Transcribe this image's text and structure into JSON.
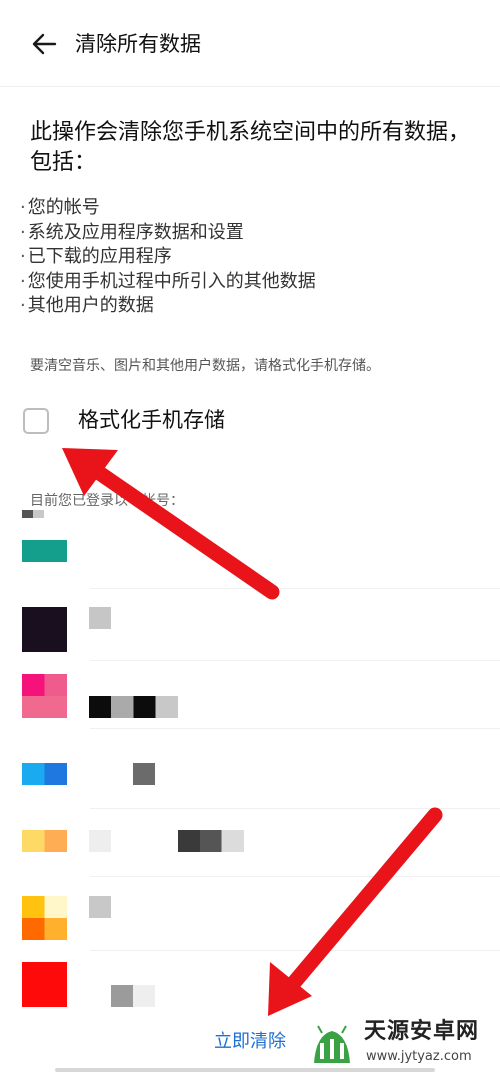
{
  "header": {
    "title": "清除所有数据",
    "back_icon": "arrow-left-icon"
  },
  "content": {
    "heading": "此操作会清除您手机系统空间中的所有数据，包括：",
    "bullets": [
      "您的帐号",
      "系统及应用程序数据和设置",
      "已下载的应用程序",
      "您使用手机过程中所引入的其他数据",
      "其他用户的数据"
    ],
    "hint": "要清空音乐、图片和其他用户数据，请格式化手机存储。",
    "format_option": {
      "label": "格式化手机存储",
      "checked": false
    },
    "accounts_label": "目前您已登录以下帐号："
  },
  "actions": {
    "clear_now": "立即清除"
  },
  "watermark": {
    "title": "天源安卓网",
    "url": "www.jytyaz.com"
  },
  "colors": {
    "accent": "#1e6fd1",
    "annotation_arrow": "#e8141a"
  }
}
